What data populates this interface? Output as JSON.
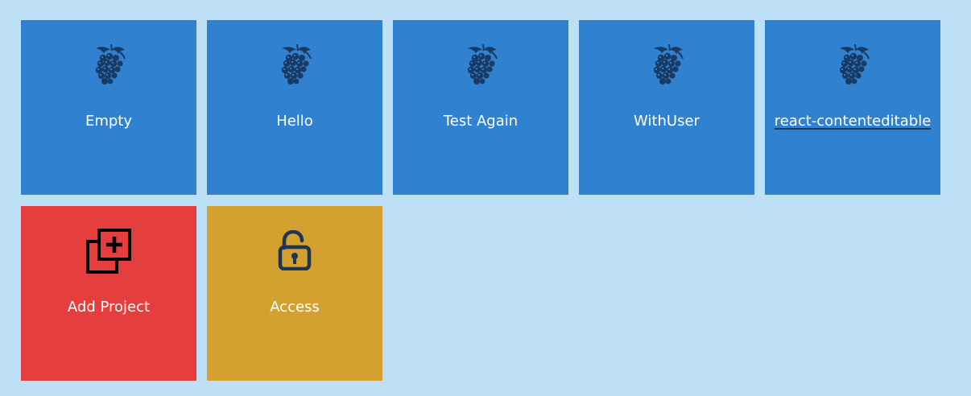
{
  "colors": {
    "background": "#bde0f6",
    "project_tile": "#3082d1",
    "add_tile": "#e43e3e",
    "access_tile": "#d4a02f",
    "grape_icon": "#183a63",
    "add_icon": "#000000",
    "lock_icon": "#1e3553",
    "label": "#ffffff"
  },
  "projects": [
    {
      "label": "Empty",
      "icon": "grape-icon"
    },
    {
      "label": "Hello",
      "icon": "grape-icon"
    },
    {
      "label": "Test Again",
      "icon": "grape-icon"
    },
    {
      "label": "WithUser",
      "icon": "grape-icon"
    },
    {
      "label": "react-contenteditable",
      "icon": "grape-icon",
      "hovered": true
    }
  ],
  "actions": {
    "add_project": {
      "label": "Add Project",
      "icon": "add-project-icon"
    },
    "access": {
      "label": "Access",
      "icon": "unlock-icon"
    }
  }
}
